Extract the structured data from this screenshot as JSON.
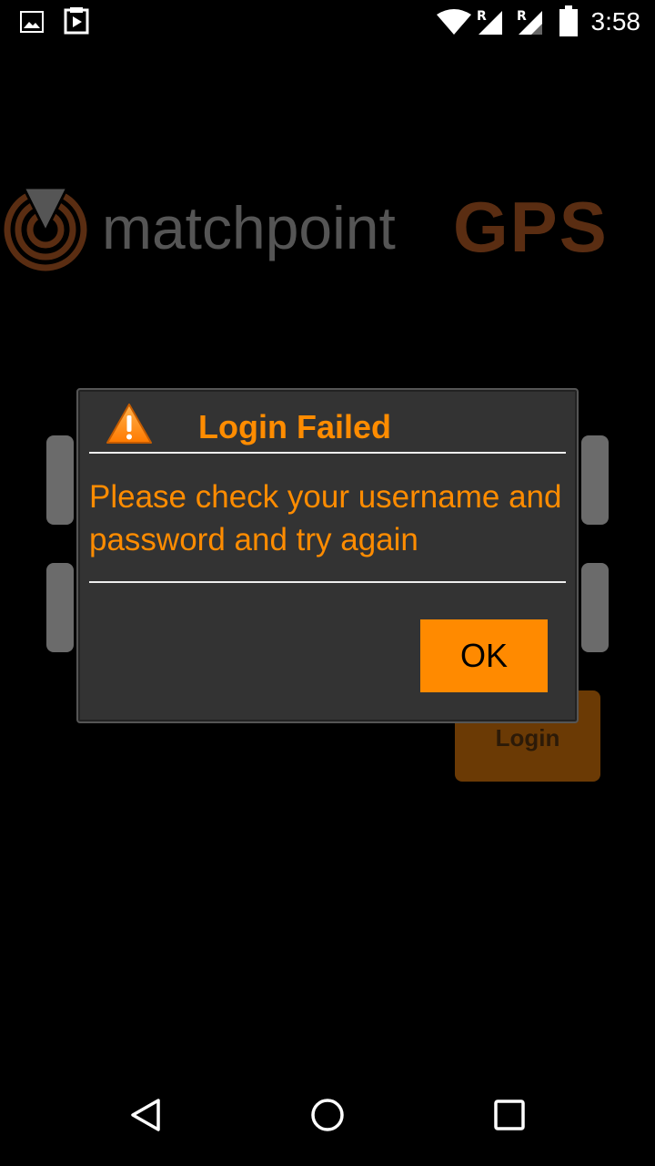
{
  "status_bar": {
    "time": "3:58",
    "icons": [
      "image-notification-icon",
      "media-notification-icon",
      "wifi-icon",
      "signal-r-icon",
      "signal-r-icon",
      "battery-icon"
    ]
  },
  "logo": {
    "brand_text": "matchpoint",
    "brand_suffix": "GPS",
    "colors": {
      "text_gray": "#555555",
      "brand_brown": "#5a2d12"
    }
  },
  "background_form": {
    "login_label": "Login"
  },
  "dialog": {
    "title": "Login Failed",
    "message": "Please check your username and password and try again",
    "ok_label": "OK",
    "icon": "warning-icon",
    "accent_color": "#ff8c00"
  },
  "nav_bar": {
    "buttons": [
      "back-icon",
      "home-icon",
      "recents-icon"
    ]
  }
}
